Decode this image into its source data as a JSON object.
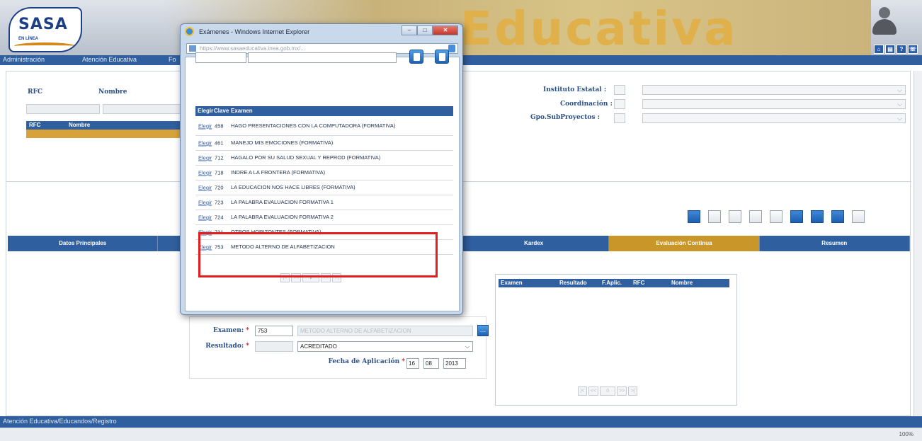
{
  "header": {
    "logo_text": "SASA",
    "logo_sub": "EN LÍNEA",
    "brand_title": "Educativa",
    "icons": [
      "home-icon",
      "doc-icon",
      "help-icon",
      "phone-icon"
    ]
  },
  "menu": {
    "items": [
      "Administración",
      "Atención Educativa",
      "Fo"
    ]
  },
  "top_form": {
    "rfc_label": "RFC",
    "nombre_label": "Nombre",
    "rfc_value": "",
    "grid_headers": {
      "rfc": "RFC",
      "nombre": "Nombre"
    },
    "grid_row": "",
    "instituto_label": "Instituto Estatal :",
    "coordinacion_label": "Coordinación :",
    "gpo_label": "Gpo.SubProyectos :"
  },
  "tabs": [
    {
      "label": "Datos Principales",
      "active": false
    },
    {
      "label": "",
      "active": false
    },
    {
      "label": "",
      "active": false
    },
    {
      "label": "Kardex",
      "active": false
    },
    {
      "label": "Evaluación Continua",
      "active": true
    },
    {
      "label": "Resumen",
      "active": false
    }
  ],
  "results": {
    "headers": [
      "Examen",
      "Resultado",
      "F.Aplic.",
      "RFC",
      "Nombre"
    ],
    "pager": [
      "|<",
      "<<",
      "0",
      ">>",
      ">|"
    ]
  },
  "form": {
    "examen_label": "Examen:",
    "examen_code": "753",
    "examen_desc": "METODO ALTERNO DE ALFABETIZACION",
    "resultado_label": "Resultado:",
    "resultado_value": "ACREDITADO",
    "fecha_label": "Fecha de Aplicación",
    "fecha_day": "16",
    "fecha_month": "08",
    "fecha_year": "2013",
    "required_mark": "*"
  },
  "status": {
    "path": "Atención Educativa/Educandos/Registro",
    "zoom": "100%"
  },
  "popup": {
    "title": "Exámenes - Windows Internet Explorer",
    "url": "https://www.sasaeducativa.inea.gob.mx/...",
    "table_headers": {
      "elegir": "Elegir",
      "clave": "Clave",
      "examen": "Examen"
    },
    "rows": [
      {
        "elegir": "Elegir",
        "clave": "458",
        "examen": "HAGO PRESENTACIONES CON LA COMPUTADORA (FORMATIVA)"
      },
      {
        "elegir": "Elegir",
        "clave": "461",
        "examen": "MANEJO MIS EMOCIONES (FORMATIVA)"
      },
      {
        "elegir": "Elegir",
        "clave": "712",
        "examen": "HAGALO POR SU SALUD SEXUAL Y REPROD (FORMATIVA)"
      },
      {
        "elegir": "Elegir",
        "clave": "718",
        "examen": "INDRE A LA FRONTERA (FORMATIVA)"
      },
      {
        "elegir": "Elegir",
        "clave": "720",
        "examen": "LA EDUCACION NOS HACE LIBRES (FORMATIVA)"
      },
      {
        "elegir": "Elegir",
        "clave": "723",
        "examen": "LA PALABRA EVALUACION FORMATIVA 1"
      },
      {
        "elegir": "Elegir",
        "clave": "724",
        "examen": "LA PALABRA EVALUACION FORMATIVA 2"
      },
      {
        "elegir": "Elegir",
        "clave": "731",
        "examen": "OTROS HORIZONTES (FORMATIVA)"
      },
      {
        "elegir": "Elegir",
        "clave": "753",
        "examen": "METODO ALTERNO DE ALFABETIZACION"
      }
    ],
    "pager": [
      "|<",
      "<<",
      "7",
      ">>",
      ">|"
    ]
  }
}
